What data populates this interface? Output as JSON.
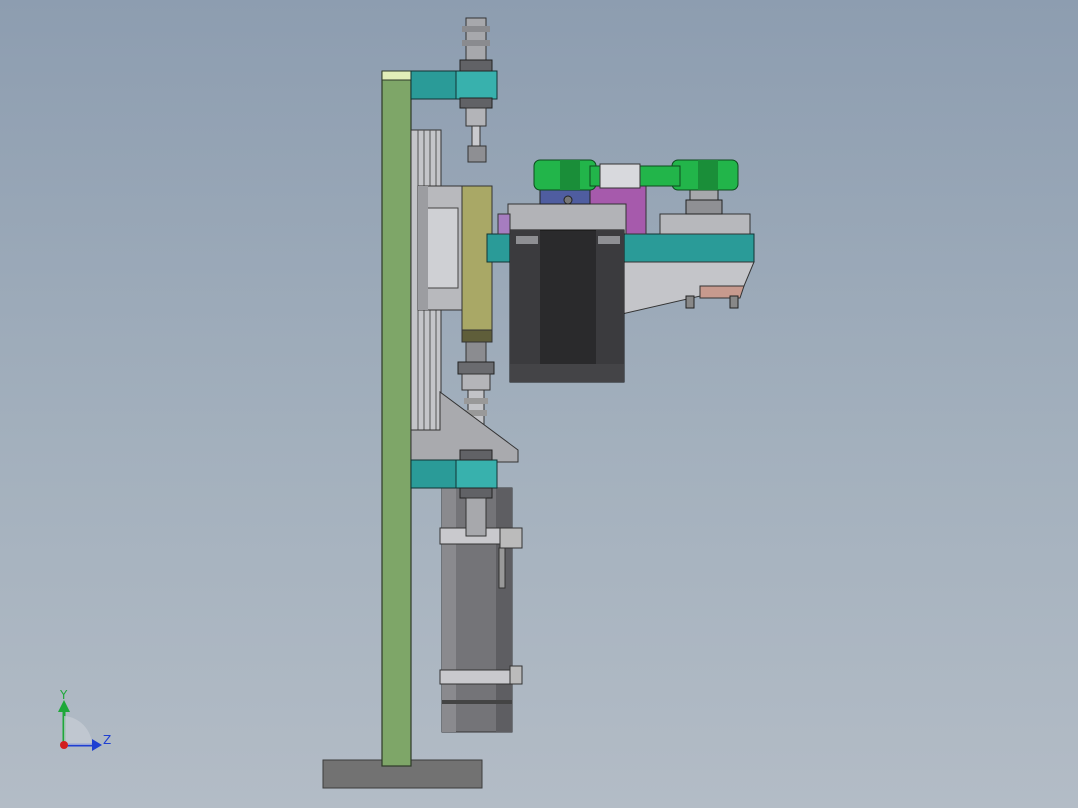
{
  "viewport": {
    "background_top": "#8d9db0",
    "background_bottom": "#b3bcc6"
  },
  "triad": {
    "y_label": "Y",
    "z_label": "Z",
    "x_color": "#d21f1f",
    "y_color": "#1fa83a",
    "z_color": "#1f3fd2"
  },
  "model": {
    "colors": {
      "column": "#7ea668",
      "column_cap": "#e2eeb8",
      "clamp_teal": "#2a9b98",
      "steel_light": "#c8c8cc",
      "steel_mid": "#a2a3a8",
      "steel_dark": "#6e6f74",
      "motor_body": "#2a2a2c",
      "belt_green": "#22b54a",
      "magenta_block": "#a65aac",
      "olive_plate": "#a9a866",
      "base_plate": "#727272",
      "cylinder": "#707074"
    }
  }
}
